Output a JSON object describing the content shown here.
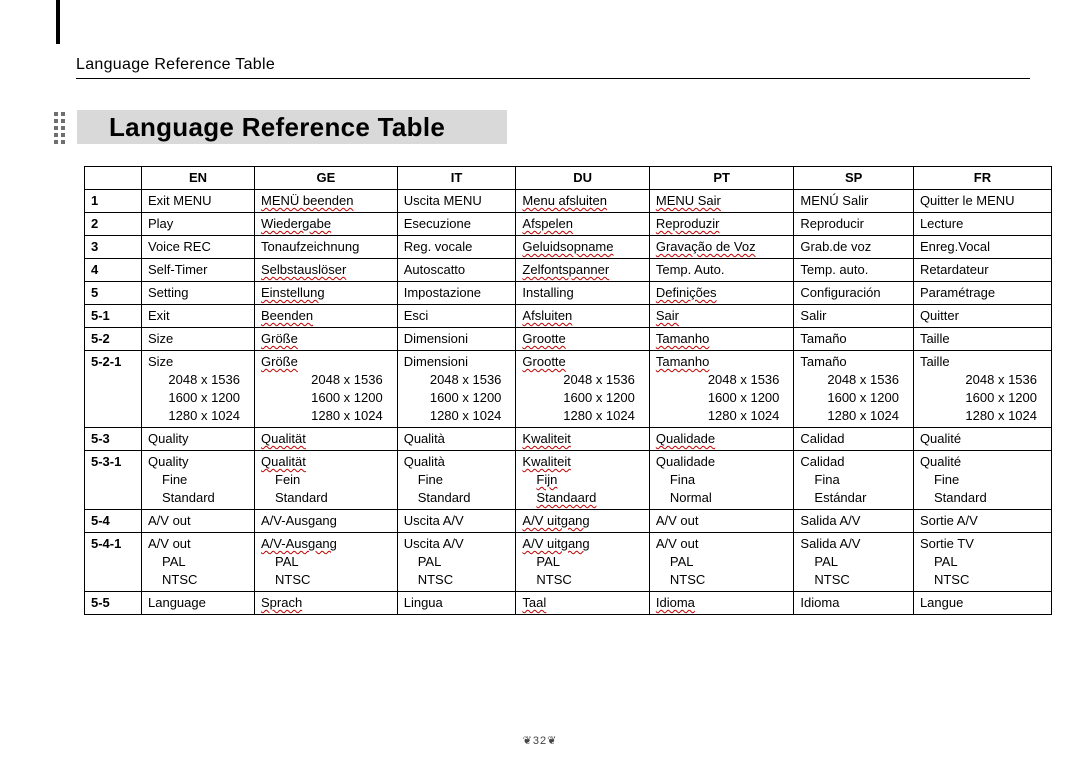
{
  "running_head": "Language Reference Table",
  "title": "Language Reference Table",
  "page_number": "32",
  "columns": [
    "",
    "EN",
    "GE",
    "IT",
    "DU",
    "PT",
    "SP",
    "FR"
  ],
  "rows": [
    {
      "id": "1",
      "cells": [
        {
          "t": "Exit MENU",
          "w": false
        },
        {
          "t": "MENÜ beenden",
          "w": true
        },
        {
          "t": "Uscita MENU",
          "w": false
        },
        {
          "t": "Menu afsluiten",
          "w": true
        },
        {
          "t": "MENU Sair",
          "w": true
        },
        {
          "t": "MENÚ Salir",
          "w": false
        },
        {
          "t": "Quitter le MENU",
          "w": false
        }
      ]
    },
    {
      "id": "2",
      "cells": [
        {
          "t": "Play",
          "w": false
        },
        {
          "t": "Wiedergabe",
          "w": true
        },
        {
          "t": "Esecuzione",
          "w": false
        },
        {
          "t": "Afspelen",
          "w": true
        },
        {
          "t": "Reproduzir",
          "w": true
        },
        {
          "t": "Reproducir",
          "w": false
        },
        {
          "t": "Lecture",
          "w": false
        }
      ]
    },
    {
      "id": "3",
      "cells": [
        {
          "t": "Voice REC",
          "w": false
        },
        {
          "t": "Tonaufzeichnung",
          "w": false
        },
        {
          "t": "Reg. vocale",
          "w": false
        },
        {
          "t": "Geluidsopname",
          "w": true
        },
        {
          "t": "Gravação de Voz",
          "w": true
        },
        {
          "t": "Grab.de voz",
          "w": false
        },
        {
          "t": "Enreg.Vocal",
          "w": false
        }
      ]
    },
    {
      "id": "4",
      "cells": [
        {
          "t": "Self-Timer",
          "w": false
        },
        {
          "t": "Selbstauslöser",
          "w": true
        },
        {
          "t": "Autoscatto",
          "w": false
        },
        {
          "t": "Zelfontspanner",
          "w": true
        },
        {
          "t": "Temp. Auto.",
          "w": false
        },
        {
          "t": "Temp. auto.",
          "w": false
        },
        {
          "t": "Retardateur",
          "w": false
        }
      ]
    },
    {
      "id": "5",
      "cells": [
        {
          "t": "Setting",
          "w": false
        },
        {
          "t": "Einstellung",
          "w": true
        },
        {
          "t": "Impostazione",
          "w": false
        },
        {
          "t": "Installing",
          "w": false
        },
        {
          "t": "Definições",
          "w": true
        },
        {
          "t": "Configuración",
          "w": false
        },
        {
          "t": "Paramétrage",
          "w": false
        }
      ]
    },
    {
      "id": "5-1",
      "cells": [
        {
          "t": "Exit",
          "w": false
        },
        {
          "t": "Beenden",
          "w": true
        },
        {
          "t": "Esci",
          "w": false
        },
        {
          "t": "Afsluiten",
          "w": true
        },
        {
          "t": "Sair",
          "w": true
        },
        {
          "t": "Salir",
          "w": false
        },
        {
          "t": "Quitter",
          "w": false
        }
      ]
    },
    {
      "id": "5-2",
      "cells": [
        {
          "t": "Size",
          "w": false
        },
        {
          "t": "Größe",
          "w": true
        },
        {
          "t": "Dimensioni",
          "w": false
        },
        {
          "t": "Grootte",
          "w": true
        },
        {
          "t": "Tamanho",
          "w": true
        },
        {
          "t": "Tamaño",
          "w": false
        },
        {
          "t": "Taille",
          "w": false
        }
      ]
    },
    {
      "id": "5-2-1",
      "cells": [
        {
          "t": "Size",
          "w": false,
          "sub": [
            "2048 x 1536",
            "1600 x 1200",
            "1280 x 1024"
          ],
          "align": "right"
        },
        {
          "t": "Größe",
          "w": true,
          "sub": [
            "2048 x 1536",
            "1600 x 1200",
            "1280 x 1024"
          ],
          "align": "right"
        },
        {
          "t": "Dimensioni",
          "w": false,
          "sub": [
            "2048 x 1536",
            "1600 x 1200",
            "1280 x 1024"
          ],
          "align": "right"
        },
        {
          "t": "Grootte",
          "w": true,
          "sub": [
            "2048 x 1536",
            "1600 x 1200",
            "1280 x 1024"
          ],
          "align": "right"
        },
        {
          "t": "Tamanho",
          "w": true,
          "sub": [
            "2048 x 1536",
            "1600 x 1200",
            "1280 x 1024"
          ],
          "align": "right"
        },
        {
          "t": "Tamaño",
          "w": false,
          "sub": [
            "2048 x 1536",
            "1600 x 1200",
            "1280 x 1024"
          ],
          "align": "right"
        },
        {
          "t": "Taille",
          "w": false,
          "sub": [
            "2048 x 1536",
            "1600 x 1200",
            "1280 x 1024"
          ],
          "align": "right"
        }
      ]
    },
    {
      "id": "5-3",
      "cells": [
        {
          "t": "Quality",
          "w": false
        },
        {
          "t": "Qualität",
          "w": true
        },
        {
          "t": "Qualità",
          "w": false
        },
        {
          "t": "Kwaliteit",
          "w": true
        },
        {
          "t": "Qualidade",
          "w": true
        },
        {
          "t": "Calidad",
          "w": false
        },
        {
          "t": "Qualité",
          "w": false
        }
      ]
    },
    {
      "id": "5-3-1",
      "cells": [
        {
          "t": "Quality",
          "w": false,
          "sub": [
            "Fine",
            "Standard"
          ]
        },
        {
          "t": "Qualität",
          "w": true,
          "sub": [
            "Fein",
            "Standard"
          ]
        },
        {
          "t": "Qualità",
          "w": false,
          "sub": [
            "Fine",
            "Standard"
          ]
        },
        {
          "t": "Kwaliteit",
          "w": true,
          "sub": [
            {
              "t": "Fijn",
              "w": true
            },
            {
              "t": "Standaard",
              "w": true
            }
          ]
        },
        {
          "t": "Qualidade",
          "w": false,
          "sub": [
            "Fina",
            "Normal"
          ]
        },
        {
          "t": "Calidad",
          "w": false,
          "sub": [
            "Fina",
            "Estándar"
          ]
        },
        {
          "t": "Qualité",
          "w": false,
          "sub": [
            "Fine",
            "Standard"
          ]
        }
      ]
    },
    {
      "id": "5-4",
      "cells": [
        {
          "t": "A/V out",
          "w": false
        },
        {
          "t": "A/V-Ausgang",
          "w": false
        },
        {
          "t": "Uscita A/V",
          "w": false
        },
        {
          "t": "A/V uitgang",
          "w": true
        },
        {
          "t": "A/V out",
          "w": false
        },
        {
          "t": "Salida A/V",
          "w": false
        },
        {
          "t": "Sortie A/V",
          "w": false
        }
      ]
    },
    {
      "id": "5-4-1",
      "cells": [
        {
          "t": "A/V out",
          "w": false,
          "sub": [
            "PAL",
            "NTSC"
          ]
        },
        {
          "t": "A/V-Ausgang",
          "w": true,
          "sub": [
            "PAL",
            "NTSC"
          ]
        },
        {
          "t": "Uscita A/V",
          "w": false,
          "sub": [
            "PAL",
            "NTSC"
          ]
        },
        {
          "t": "A/V uitgang",
          "w": true,
          "sub": [
            "PAL",
            "NTSC"
          ]
        },
        {
          "t": "A/V out",
          "w": false,
          "sub": [
            "PAL",
            "NTSC"
          ]
        },
        {
          "t": "Salida A/V",
          "w": false,
          "sub": [
            "PAL",
            "NTSC"
          ]
        },
        {
          "t": "Sortie TV",
          "w": false,
          "sub": [
            "PAL",
            "NTSC"
          ]
        }
      ]
    },
    {
      "id": "5-5",
      "cells": [
        {
          "t": "Language",
          "w": false
        },
        {
          "t": "Sprach",
          "w": true
        },
        {
          "t": "Lingua",
          "w": false
        },
        {
          "t": "Taal",
          "w": true
        },
        {
          "t": "Idioma",
          "w": true
        },
        {
          "t": "Idioma",
          "w": false
        },
        {
          "t": "Langue",
          "w": false
        }
      ]
    }
  ]
}
